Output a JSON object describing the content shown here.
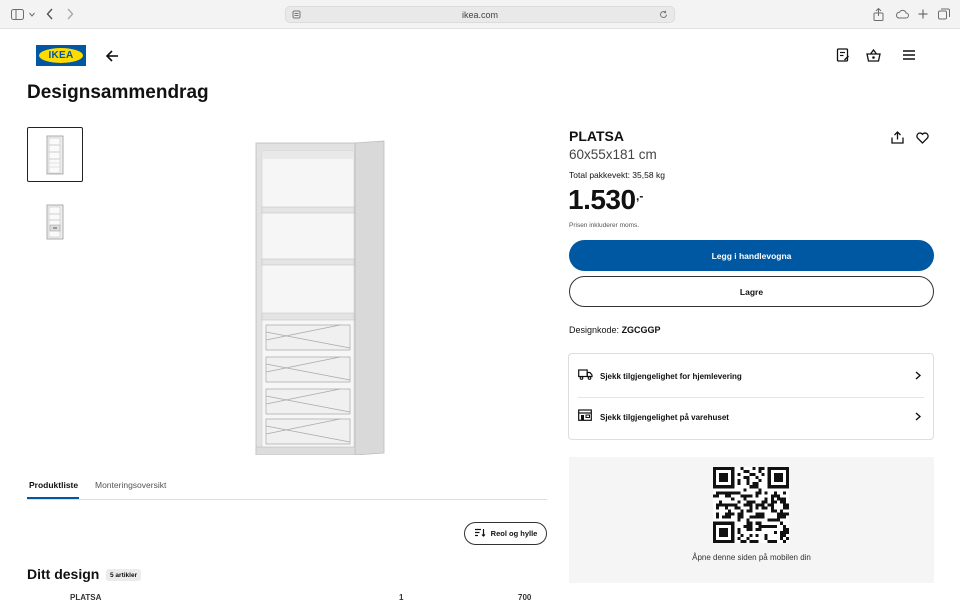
{
  "browser": {
    "url": "ikea.com"
  },
  "header": {
    "logo_text": "IKEA"
  },
  "page": {
    "title": "Designsammendrag"
  },
  "tabs": [
    {
      "label": "Produktliste"
    },
    {
      "label": "Monteringsoversikt"
    }
  ],
  "filter": {
    "label": "Reol og hylle"
  },
  "design": {
    "title": "Ditt design",
    "badge": "5 artikler",
    "row_name": "PLATSA",
    "row_qty": "1",
    "row_price": "700"
  },
  "product": {
    "name": "PLATSA",
    "dimensions": "60x55x181 cm",
    "weight": "Total pakkevekt: 35,58 kg",
    "price": "1.530",
    "price_suffix": ",-",
    "vat": "Prisen inkluderer moms."
  },
  "buttons": {
    "add_to_cart": "Legg i handlevogna",
    "save": "Lagre"
  },
  "design_code": {
    "label": "Designkode:",
    "value": "ZGCGGP"
  },
  "availability": [
    {
      "label": "Sjekk tilgjengelighet for hjemlevering",
      "icon": "truck-icon"
    },
    {
      "label": "Sjekk tilgjengelighet på varehuset",
      "icon": "store-icon"
    }
  ],
  "qr": {
    "text": "Åpne denne siden på mobilen din"
  },
  "colors": {
    "brand_blue": "#0058a3",
    "brand_yellow": "#ffdb00"
  }
}
